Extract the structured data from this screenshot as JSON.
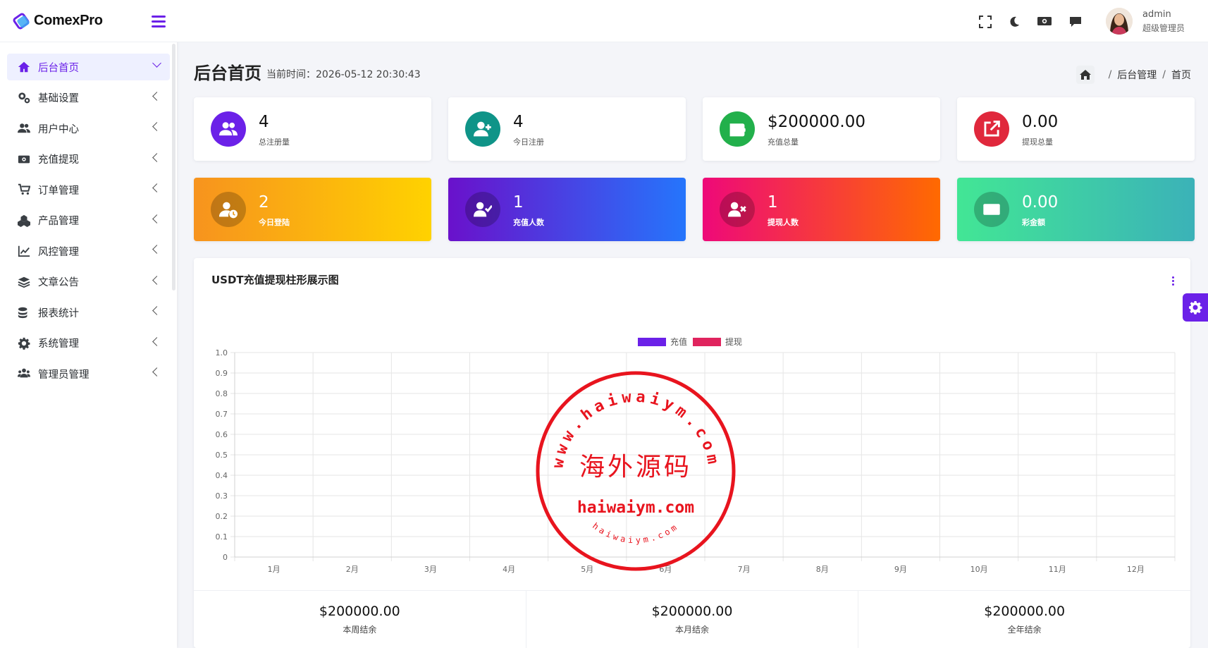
{
  "app": {
    "logo_text": "ComexPro"
  },
  "sidebar": {
    "items": [
      {
        "label": "后台首页",
        "icon": "home-icon",
        "active": true
      },
      {
        "label": "基础设置",
        "icon": "gears-icon"
      },
      {
        "label": "用户中心",
        "icon": "users-icon"
      },
      {
        "label": "充值提现",
        "icon": "money-bill-icon"
      },
      {
        "label": "订单管理",
        "icon": "cart-icon"
      },
      {
        "label": "产品管理",
        "icon": "cubes-icon"
      },
      {
        "label": "风控管理",
        "icon": "line-chart-icon"
      },
      {
        "label": "文章公告",
        "icon": "layers-icon"
      },
      {
        "label": "报表统计",
        "icon": "coins-icon"
      },
      {
        "label": "系统管理",
        "icon": "gear-icon"
      },
      {
        "label": "管理员管理",
        "icon": "user-group-icon"
      }
    ]
  },
  "topbar": {
    "icons": [
      "fullscreen-icon",
      "moon-icon",
      "money-icon",
      "chat-icon"
    ],
    "user_name": "admin",
    "user_role": "超级管理员"
  },
  "page": {
    "title": "后台首页",
    "time_label": "当前时间：2026-05-12 20:30:43",
    "breadcrumb": [
      "后台管理",
      "首页"
    ]
  },
  "stats": [
    {
      "value": "4",
      "label": "总注册量",
      "icon": "users-icon",
      "color": "#6b21e8"
    },
    {
      "value": "4",
      "label": "今日注册",
      "icon": "user-plus-icon",
      "color": "#0f9488"
    },
    {
      "value": "$200000.00",
      "label": "充值总量",
      "icon": "wallet-icon",
      "color": "#22b04b"
    },
    {
      "value": "0.00",
      "label": "提现总量",
      "icon": "external-link-icon",
      "color": "#e0283c"
    }
  ],
  "gradient_stats": [
    {
      "value": "2",
      "label": "今日登陆",
      "icon": "user-clock-icon",
      "from": "#f7931e",
      "to": "#ffd200"
    },
    {
      "value": "1",
      "label": "充值人数",
      "icon": "user-check-icon",
      "from": "#6a11cb",
      "to": "#2575fc"
    },
    {
      "value": "1",
      "label": "提现人数",
      "icon": "user-times-icon",
      "from": "#ee0979",
      "to": "#ff6a00"
    },
    {
      "value": "0.00",
      "label": "彩金额",
      "icon": "money-bill-icon",
      "from": "#42e695",
      "to": "#3bb2b8"
    }
  ],
  "chart_title": "USDT充值提现柱形展示图",
  "chart_data": {
    "type": "bar",
    "categories": [
      "1月",
      "2月",
      "3月",
      "4月",
      "5月",
      "6月",
      "7月",
      "8月",
      "9月",
      "10月",
      "11月",
      "12月"
    ],
    "series": [
      {
        "name": "充值",
        "color": "#6b21e8",
        "values": [
          0,
          0,
          0,
          0,
          0,
          0,
          0,
          0,
          0,
          0,
          0,
          0
        ]
      },
      {
        "name": "提现",
        "color": "#e0245e",
        "values": [
          0,
          0,
          0,
          0,
          0,
          0,
          0,
          0,
          0,
          0,
          0,
          0
        ]
      }
    ],
    "y_ticks": [
      "1.0",
      "0.9",
      "0.8",
      "0.7",
      "0.6",
      "0.5",
      "0.4",
      "0.3",
      "0.2",
      "0.1",
      "0"
    ],
    "ylim": [
      0,
      1.0
    ],
    "grid": true,
    "legend": "top-center"
  },
  "summary": [
    {
      "value": "$200000.00",
      "label": "本周结余"
    },
    {
      "value": "$200000.00",
      "label": "本月结余"
    },
    {
      "value": "$200000.00",
      "label": "全年结余"
    }
  ],
  "watermark": {
    "top_arc": "www.haiwaiym.com",
    "center": "海外源码",
    "domain": "haiwaiym.com",
    "bottom_arc": "haiwaiym.com"
  }
}
